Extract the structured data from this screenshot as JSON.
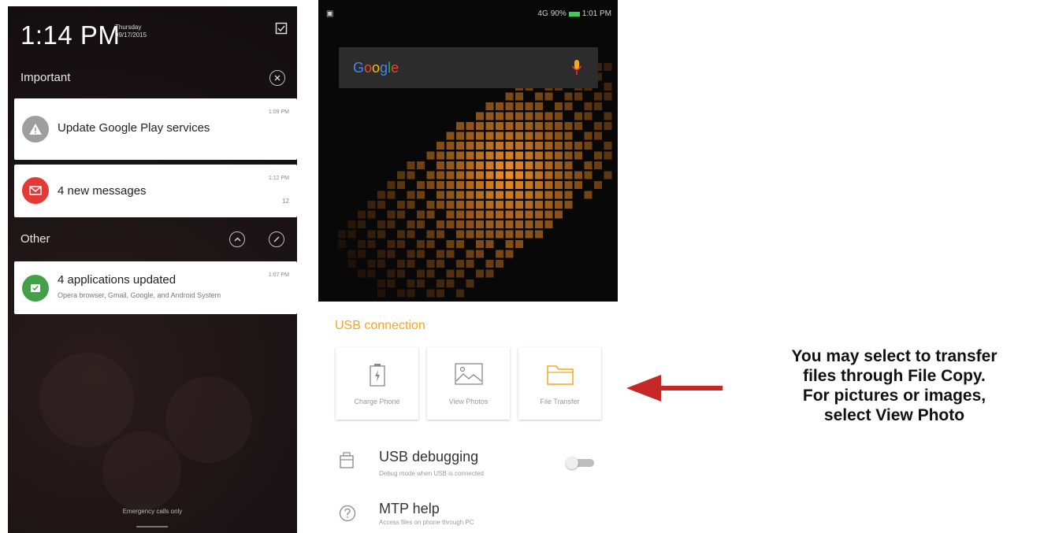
{
  "notification_shade": {
    "time": "1:14 PM",
    "day": "Thursday",
    "date": "09/17/2015",
    "sections": {
      "important": "Important",
      "other": "Other"
    },
    "notifications": [
      {
        "title": "Update Google Play services",
        "time": "1:09 PM",
        "icon": "warning-icon",
        "color": "#9e9e9e"
      },
      {
        "title": "4 new messages",
        "time": "1:12 PM",
        "count": "12",
        "icon": "mail-icon",
        "color": "#e53935"
      },
      {
        "title": "4 applications updated",
        "time": "1:07 PM",
        "detail": "Opera browser, Gmail, Google, and Android System",
        "icon": "update-icon",
        "color": "#43a047"
      }
    ],
    "footer": "Emergency calls only"
  },
  "home_screen": {
    "status": {
      "signal": "4G",
      "battery_percent": "90%",
      "time": "1:01 PM",
      "battery_color": "#3ecf5a"
    },
    "search": {
      "logo": "Google",
      "mic_icon": "mic-icon",
      "mic_color": "#f5a623"
    }
  },
  "usb_panel": {
    "title": "USB connection",
    "accent_color": "#f5a623",
    "options": [
      {
        "label": "Charge Phone",
        "icon": "battery-charge-icon"
      },
      {
        "label": "View Photos",
        "icon": "image-icon"
      },
      {
        "label": "File Transfer",
        "icon": "folder-icon"
      }
    ],
    "debugging": {
      "title": "USB debugging",
      "subtitle": "Debug mode when USB is connected",
      "enabled": false
    },
    "mtp": {
      "title": "MTP help",
      "subtitle": "Access files on phone through PC"
    }
  },
  "annotation": {
    "lines": [
      "You may select to transfer",
      "files through File Copy.",
      "For pictures or images,",
      "select View Photo"
    ],
    "arrow_color": "#c62828"
  }
}
